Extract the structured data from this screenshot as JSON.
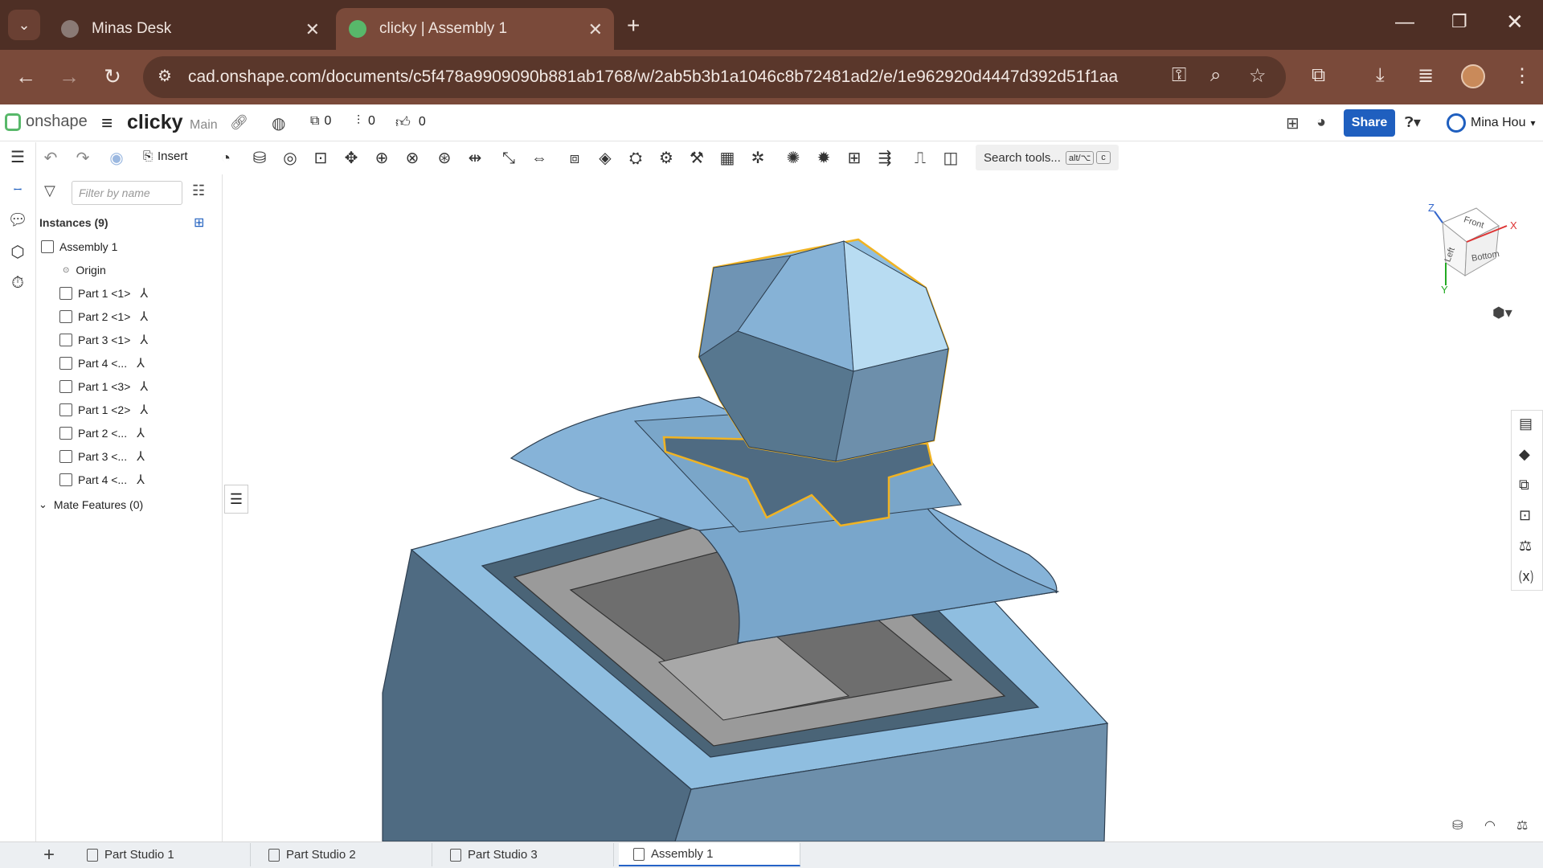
{
  "browser": {
    "tabs": [
      {
        "title": "Minas Desk",
        "active": false
      },
      {
        "title": "clicky | Assembly 1",
        "active": true
      }
    ],
    "url": "cad.onshape.com/documents/c5f478a9909090b881ab1768/w/2ab5b3b1a1046c8b72481ad2/e/1e962920d4447d392d51f1aa"
  },
  "header": {
    "logo": "onshape",
    "doc_title": "clicky",
    "branch": "Main",
    "versions_count": "0",
    "branch_count": "0",
    "likes_count": "0",
    "share_label": "Share",
    "user_name": "Mina Hou"
  },
  "toolbar": {
    "insert_label": "Insert",
    "search_placeholder": "Search tools...",
    "shortcut_1": "alt/⌥",
    "shortcut_2": "c"
  },
  "panel": {
    "filter_placeholder": "Filter by name",
    "instances_header": "Instances (9)",
    "assembly_label": "Assembly 1",
    "origin_label": "Origin",
    "instances": [
      "Part 1 <1>",
      "Part 2 <1>",
      "Part 3 <1>",
      "Part 4 <...",
      "Part 1 <3>",
      "Part 1 <2>",
      "Part 2 <...",
      "Part 3 <...",
      "Part 4 <..."
    ],
    "mate_features_label": "Mate Features (0)"
  },
  "viewcube": {
    "faces": [
      "Front",
      "Left",
      "Bottom"
    ],
    "axes": [
      "X",
      "Y",
      "Z"
    ]
  },
  "bottom_tabs": [
    "Part Studio 1",
    "Part Studio 2",
    "Part Studio 3",
    "Assembly 1"
  ],
  "colors": {
    "tab_bar": "#4e2f25",
    "url_bar": "#7a4a3a",
    "share_button": "#1f5fbf",
    "model_blue": "#8ab7dc",
    "selection_outline": "#f0b323"
  }
}
